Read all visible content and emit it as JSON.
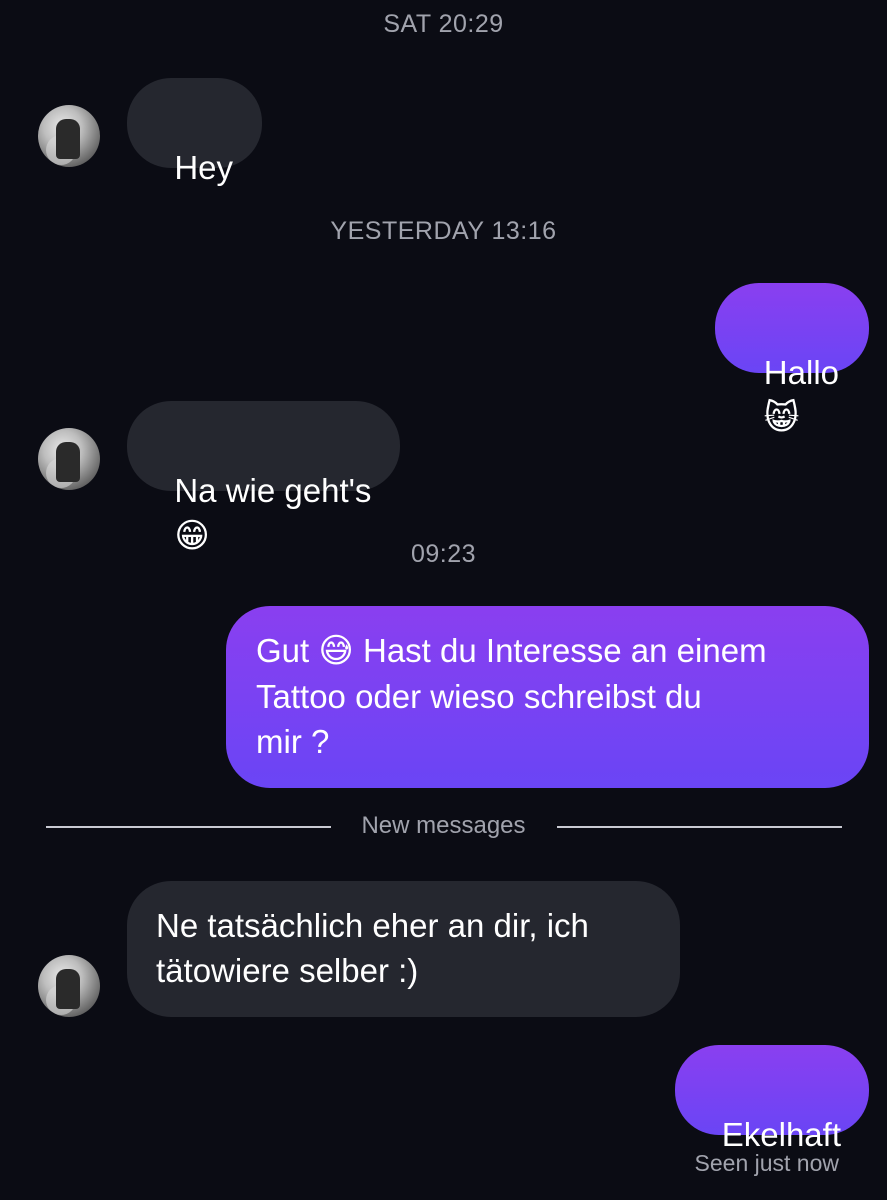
{
  "conversation": {
    "timestamps": {
      "t1": "SAT 20:29",
      "t2": "YESTERDAY 13:16",
      "t3": "09:23"
    },
    "messages": [
      {
        "direction": "incoming",
        "text": "Hey"
      },
      {
        "direction": "outgoing",
        "text": "Hallo",
        "emoji": "😸"
      },
      {
        "direction": "incoming",
        "text": "Na wie geht's",
        "emoji": "😁"
      },
      {
        "direction": "outgoing",
        "text_prefix": "Gut",
        "emoji": "😅",
        "text": "Hast du Interesse an einem\nTattoo oder wieso schreibst du\nmir ?"
      },
      {
        "direction": "incoming",
        "text": "Ne tatsächlich eher an dir, ich\ntätowiere selber :)"
      },
      {
        "direction": "outgoing",
        "text": "Ekelhaft"
      }
    ],
    "new_messages_label": "New messages",
    "seen_status": "Seen just now"
  },
  "colors": {
    "background": "#0b0c14",
    "incoming_bubble": "#25272f",
    "outgoing_bubble_top": "#8a3ff0",
    "outgoing_bubble_bottom": "#6a45f5",
    "meta_text": "#a1a3ad"
  },
  "icons": {
    "avatar": "user-avatar-photo"
  }
}
